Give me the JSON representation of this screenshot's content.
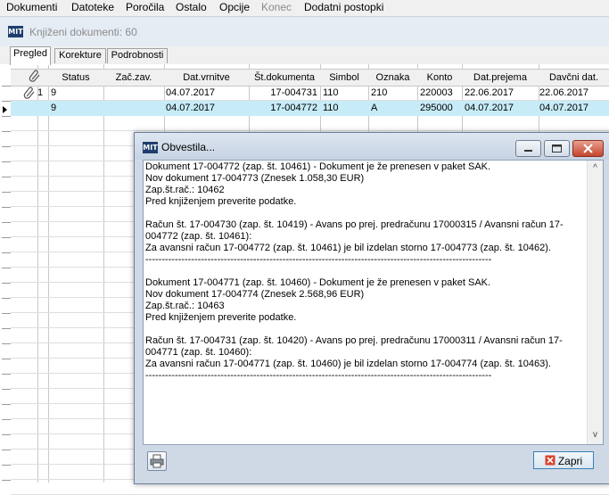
{
  "menu": {
    "items": [
      {
        "label": "Dokumenti",
        "disabled": false
      },
      {
        "label": "Datoteke",
        "disabled": false
      },
      {
        "label": "Poročila",
        "disabled": false
      },
      {
        "label": "Ostalo",
        "disabled": false
      },
      {
        "label": "Opcije",
        "disabled": false
      },
      {
        "label": "Konec",
        "disabled": true
      },
      {
        "label": "Dodatni postopki",
        "disabled": false
      }
    ]
  },
  "window": {
    "logo": "MIT",
    "title": "Knjiženi dokumenti: 60"
  },
  "tabs": [
    {
      "label": "Pregled",
      "active": true
    },
    {
      "label": "Korekture",
      "active": false
    },
    {
      "label": "Podrobnosti",
      "active": false
    }
  ],
  "grid": {
    "columns": [
      "Status",
      "Zač.zav.",
      "Dat.vrnitve",
      "Št.dokumenta",
      "Simbol",
      "Oznaka",
      "Konto",
      "Dat.prejema",
      "Davčni dat."
    ],
    "rows": [
      {
        "num": "1",
        "attachment": true,
        "selected": false,
        "cells": [
          "9",
          "",
          "04.07.2017",
          "17-004731",
          "110",
          "210",
          "220003",
          "22.06.2017",
          "22.06.2017"
        ]
      },
      {
        "num": "",
        "attachment": false,
        "selected": true,
        "cells": [
          "9",
          "",
          "04.07.2017",
          "17-004772",
          "110",
          "A",
          "295000",
          "04.07.2017",
          "04.07.2017"
        ]
      }
    ]
  },
  "dialog": {
    "logo": "MIT",
    "title": "Obvestila...",
    "message": "Dokument 17-004772 (zap. št. 10461) - Dokument je že prenesen v paket SAK.\nNov dokument 17-004773 (Znesek 1.058,30 EUR)\nZap.št.rač.: 10462\nPred knjiženjem preverite podatke.\n\nRačun št. 17-004730 (zap. št. 10419) - Avans po prej. predračunu 17000315 / Avansni račun 17-004772 (zap. št. 10461):\nZa avansni račun 17-004772 (zap. št. 10461) je bil izdelan storno 17-004773 (zap. št. 10462).\n----------------------------------------------------------------------------------------------------------\n\nDokument 17-004771 (zap. št. 10460) - Dokument je že prenesen v paket SAK.\nNov dokument 17-004774 (Znesek 2.568,96 EUR)\nZap.št.rač.: 10463\nPred knjiženjem preverite podatke.\n\nRačun št. 17-004731 (zap. št. 10420) - Avans po prej. predračunu 17000311 / Avansni račun 17-004771 (zap. št. 10460):\nZa avansni račun 17-004771 (zap. št. 10460) je bil izdelan storno 17-004774 (zap. št. 10463).\n----------------------------------------------------------------------------------------------------------",
    "close_label": "Zapri",
    "scroll_up": "^",
    "scroll_down": "v"
  }
}
